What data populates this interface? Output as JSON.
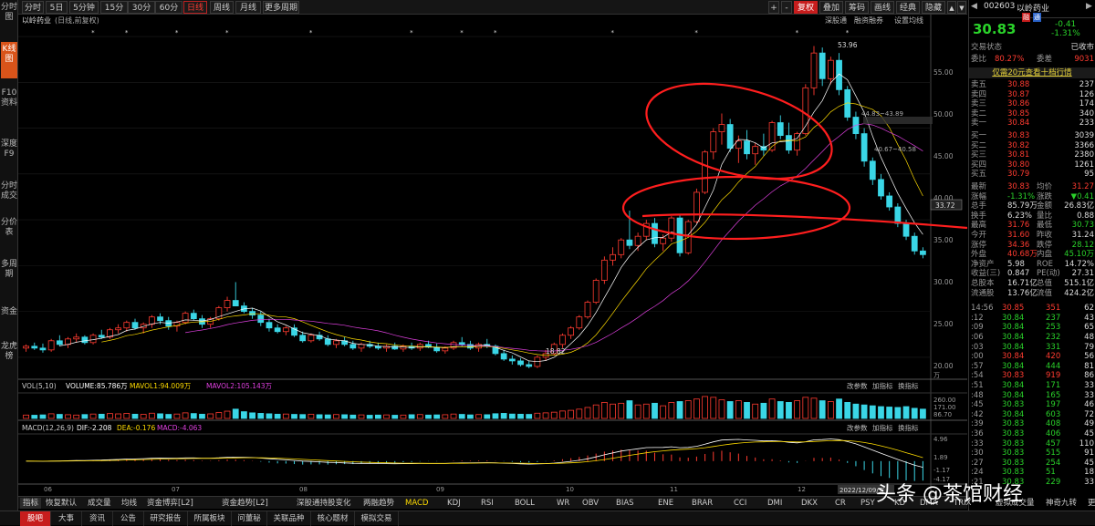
{
  "sidebar": {
    "items": [
      "分时图",
      "K线图",
      "F10资料",
      "深度F9",
      "分时成交",
      "分价表",
      "多周期",
      "资金",
      "龙虎榜"
    ],
    "active": 1
  },
  "toolbar": {
    "periods": [
      "分时",
      "5日",
      "5分钟",
      "15分钟",
      "30分钟",
      "60分钟",
      "日线",
      "周线",
      "月线",
      "更多周期"
    ],
    "selected_period": "日线",
    "right_buttons": [
      "+",
      "-",
      "复权",
      "叠加",
      "筹码",
      "画线",
      "经典",
      "隐藏"
    ],
    "right_icons": [
      "▲",
      "▼",
      "◀",
      "▶"
    ]
  },
  "chart": {
    "stock_label": "以岭药业",
    "stock_label_sub": "(日线,前复权)",
    "subtoolbar": [
      "深股通",
      "融资融券",
      "设置均线"
    ],
    "price_axis": [
      "55.00",
      "50.00",
      "45.00",
      "40.00",
      "35.00",
      "30.00",
      "25.00",
      "20.00"
    ],
    "current_price_tag": "33.72",
    "high_label": "53.96",
    "low_label": "18.82",
    "range_label_1": "44.83~43.89",
    "range_label_2": "40.67~40.58",
    "month_labels": [
      "06",
      "07",
      "08",
      "09",
      "10",
      "11",
      "12"
    ],
    "date_tag": "2022/12/09/五",
    "vol_header": "VOL(5,10)",
    "vol_values": [
      "VOLUME:85.786万",
      "MAVOL1:94.009万",
      "MAVOL2:105.143万"
    ],
    "vol_right": [
      "改参数",
      "加指标",
      "换指标"
    ],
    "vol_axis": [
      "260.00",
      "171.00",
      "86.70",
      "万"
    ],
    "macd_header": "MACD(12,26,9)",
    "macd_values": [
      "DIF:-2.208",
      "DEA:-0.176",
      "MACD:-4.063"
    ],
    "macd_right": [
      "改参数",
      "加指标",
      "换指标"
    ],
    "macd_axis": [
      "4.96",
      "1.89",
      "-1.17",
      "-4.17"
    ]
  },
  "chart_data": {
    "type": "candlestick",
    "title": "以岭药业 (日线,前复权)",
    "ylim": [
      18,
      56
    ],
    "candles": [
      [
        21.0,
        21.4,
        20.6,
        21.2
      ],
      [
        21.2,
        21.6,
        20.8,
        21.0
      ],
      [
        21.0,
        21.5,
        20.5,
        20.8
      ],
      [
        20.8,
        22.0,
        20.6,
        21.8
      ],
      [
        21.8,
        22.4,
        21.2,
        21.4
      ],
      [
        21.4,
        22.2,
        21.0,
        22.0
      ],
      [
        22.0,
        22.6,
        21.6,
        22.2
      ],
      [
        22.2,
        22.4,
        21.4,
        21.6
      ],
      [
        21.6,
        22.6,
        21.4,
        22.4
      ],
      [
        22.4,
        23.0,
        22.0,
        22.2
      ],
      [
        22.2,
        23.2,
        22.0,
        23.0
      ],
      [
        23.0,
        23.6,
        22.6,
        23.2
      ],
      [
        23.2,
        24.0,
        22.8,
        23.8
      ],
      [
        23.8,
        24.2,
        23.0,
        23.2
      ],
      [
        23.2,
        23.8,
        22.6,
        23.6
      ],
      [
        23.6,
        24.6,
        23.2,
        24.4
      ],
      [
        24.4,
        24.8,
        23.6,
        24.0
      ],
      [
        24.0,
        24.4,
        23.0,
        23.4
      ],
      [
        23.4,
        24.0,
        22.8,
        23.8
      ],
      [
        23.8,
        25.0,
        23.6,
        24.8
      ],
      [
        24.8,
        25.2,
        24.0,
        24.2
      ],
      [
        24.2,
        24.6,
        23.2,
        23.6
      ],
      [
        23.6,
        24.4,
        23.2,
        24.2
      ],
      [
        24.2,
        25.6,
        24.0,
        25.4
      ],
      [
        25.4,
        26.6,
        25.0,
        26.2
      ],
      [
        26.2,
        28.2,
        25.8,
        25.6
      ],
      [
        25.6,
        26.0,
        24.8,
        25.0
      ],
      [
        25.0,
        25.4,
        24.2,
        24.6
      ],
      [
        24.6,
        25.0,
        23.4,
        23.8
      ],
      [
        23.8,
        24.2,
        22.8,
        23.2
      ],
      [
        23.2,
        23.6,
        22.6,
        22.8
      ],
      [
        22.8,
        23.4,
        22.4,
        23.2
      ],
      [
        23.2,
        23.6,
        22.2,
        22.4
      ],
      [
        22.4,
        22.8,
        21.6,
        21.8
      ],
      [
        21.8,
        22.6,
        21.6,
        22.4
      ],
      [
        22.4,
        22.8,
        21.8,
        22.0
      ],
      [
        22.0,
        22.4,
        21.2,
        21.4
      ],
      [
        21.4,
        22.0,
        21.0,
        21.8
      ],
      [
        21.8,
        22.2,
        21.2,
        21.4
      ],
      [
        21.4,
        21.8,
        20.8,
        21.0
      ],
      [
        21.0,
        21.6,
        20.6,
        21.4
      ],
      [
        21.4,
        21.8,
        21.0,
        21.2
      ],
      [
        21.2,
        21.6,
        20.8,
        21.0
      ],
      [
        21.0,
        21.4,
        20.6,
        21.2
      ],
      [
        21.2,
        21.6,
        20.8,
        20.9
      ],
      [
        20.9,
        21.4,
        20.6,
        21.2
      ],
      [
        21.2,
        21.6,
        20.8,
        21.0
      ],
      [
        21.0,
        21.6,
        20.7,
        21.4
      ],
      [
        21.4,
        21.8,
        21.0,
        21.1
      ],
      [
        21.1,
        21.5,
        20.5,
        20.7
      ],
      [
        20.7,
        21.2,
        20.4,
        21.0
      ],
      [
        21.0,
        21.8,
        20.8,
        21.6
      ],
      [
        21.6,
        22.2,
        21.2,
        21.4
      ],
      [
        21.4,
        21.8,
        20.8,
        21.0
      ],
      [
        21.0,
        21.6,
        20.6,
        21.4
      ],
      [
        21.4,
        22.0,
        21.0,
        21.2
      ],
      [
        21.2,
        21.4,
        20.2,
        20.4
      ],
      [
        20.4,
        20.8,
        19.6,
        19.8
      ],
      [
        19.8,
        20.2,
        19.2,
        19.6
      ],
      [
        19.6,
        19.9,
        19.0,
        19.2
      ],
      [
        19.2,
        19.6,
        18.8,
        19.0
      ],
      [
        19.0,
        20.2,
        18.82,
        20.0
      ],
      [
        20.0,
        20.8,
        19.6,
        20.4
      ],
      [
        20.4,
        21.6,
        20.2,
        21.4
      ],
      [
        21.4,
        22.6,
        21.0,
        22.4
      ],
      [
        22.4,
        23.4,
        22.0,
        23.2
      ],
      [
        23.2,
        24.6,
        23.0,
        24.4
      ],
      [
        24.4,
        26.2,
        24.2,
        26.0
      ],
      [
        26.0,
        28.6,
        25.8,
        28.4
      ],
      [
        28.4,
        31.0,
        28.0,
        30.6
      ],
      [
        30.6,
        32.0,
        30.0,
        31.2
      ],
      [
        31.2,
        33.0,
        30.8,
        32.8
      ],
      [
        32.8,
        36.0,
        31.8,
        32.2
      ],
      [
        32.2,
        33.6,
        31.6,
        33.2
      ],
      [
        33.2,
        35.0,
        32.8,
        34.6
      ],
      [
        34.6,
        35.2,
        32.0,
        32.4
      ],
      [
        32.4,
        33.4,
        31.6,
        33.0
      ],
      [
        33.0,
        35.4,
        32.6,
        35.2
      ],
      [
        35.2,
        35.6,
        31.0,
        31.4
      ],
      [
        31.4,
        35.0,
        31.2,
        34.8
      ],
      [
        34.8,
        38.4,
        34.6,
        38.0
      ],
      [
        38.0,
        42.6,
        37.8,
        42.4
      ],
      [
        42.4,
        45.0,
        41.6,
        44.6
      ],
      [
        44.6,
        46.6,
        43.2,
        45.4
      ],
      [
        45.4,
        46.0,
        42.4,
        42.8
      ],
      [
        42.8,
        44.2,
        41.2,
        43.6
      ],
      [
        43.6,
        44.8,
        41.6,
        42.2
      ],
      [
        42.2,
        43.4,
        41.0,
        43.0
      ],
      [
        43.0,
        44.4,
        42.0,
        42.6
      ],
      [
        42.6,
        45.8,
        42.4,
        45.6
      ],
      [
        45.6,
        46.4,
        43.8,
        44.2
      ],
      [
        44.2,
        45.6,
        42.2,
        42.6
      ],
      [
        42.6,
        44.6,
        42.0,
        44.4
      ],
      [
        44.4,
        49.8,
        44.2,
        49.4
      ],
      [
        49.4,
        53.96,
        48.6,
        53.2
      ],
      [
        53.2,
        53.8,
        49.6,
        50.4
      ],
      [
        50.4,
        52.8,
        49.8,
        52.4
      ],
      [
        52.4,
        53.2,
        48.6,
        49.2
      ],
      [
        49.2,
        49.6,
        45.8,
        46.2
      ],
      [
        46.2,
        46.8,
        43.8,
        44.4
      ],
      [
        44.4,
        45.0,
        40.8,
        41.4
      ],
      [
        41.4,
        41.8,
        38.8,
        39.4
      ],
      [
        39.4,
        40.0,
        37.2,
        37.6
      ],
      [
        37.6,
        38.0,
        36.0,
        36.4
      ],
      [
        36.4,
        36.8,
        34.2,
        34.6
      ],
      [
        34.6,
        35.0,
        32.8,
        33.2
      ],
      [
        33.2,
        33.6,
        31.2,
        31.6
      ],
      [
        31.6,
        32.0,
        30.8,
        31.2
      ]
    ],
    "volume": [
      40,
      38,
      42,
      55,
      48,
      44,
      40,
      46,
      52,
      50,
      58,
      54,
      60,
      50,
      48,
      62,
      55,
      48,
      52,
      66,
      58,
      50,
      54,
      70,
      86,
      110,
      80,
      66,
      60,
      55,
      50,
      52,
      48,
      46,
      50,
      44,
      42,
      46,
      44,
      40,
      42,
      38,
      40,
      42,
      38,
      40,
      44,
      46,
      40,
      42,
      44,
      52,
      48,
      42,
      46,
      44,
      56,
      60,
      52,
      50,
      48,
      62,
      66,
      74,
      88,
      96,
      110,
      130,
      160,
      190,
      170,
      180,
      210,
      160,
      170,
      180,
      150,
      190,
      200,
      210,
      230,
      260,
      250,
      220,
      200,
      210,
      190,
      170,
      180,
      230,
      200,
      190,
      210,
      250,
      240,
      210,
      200,
      230,
      190,
      170,
      160,
      150,
      140,
      135,
      130,
      140,
      120,
      110
    ],
    "vol_ylim": [
      0,
      270
    ],
    "macd_ylim": [
      -5,
      6
    ]
  },
  "rpanel": {
    "code": "002603",
    "name": "以岭药业",
    "badges": [
      "融",
      "通"
    ],
    "price": "30.83",
    "change": "-0.41",
    "pct": "-1.31%",
    "status_label": "交易状态",
    "status_value": "已收市",
    "weibi_label": "委比",
    "weibi_value": "80.27%",
    "weicha_label": "委差",
    "weicha_value": "9031",
    "promo": "仅需20元查看十档行情",
    "sells": [
      [
        "卖五",
        "30.88",
        "237"
      ],
      [
        "卖四",
        "30.87",
        "126"
      ],
      [
        "卖三",
        "30.86",
        "174"
      ],
      [
        "卖二",
        "30.85",
        "340"
      ],
      [
        "卖一",
        "30.84",
        "233"
      ]
    ],
    "buys": [
      [
        "买一",
        "30.83",
        "3039"
      ],
      [
        "买二",
        "30.82",
        "3366"
      ],
      [
        "买三",
        "30.81",
        "2380"
      ],
      [
        "买四",
        "30.80",
        "1261"
      ],
      [
        "买五",
        "30.79",
        "95"
      ]
    ],
    "stats": [
      [
        "最新",
        "30.83",
        "均价",
        "31.27"
      ],
      [
        "涨幅",
        "-1.31%",
        "涨跌",
        "▼0.41"
      ],
      [
        "总手",
        "85.79万",
        "金额",
        "26.83亿"
      ],
      [
        "换手",
        "6.23%",
        "量比",
        "0.88"
      ],
      [
        "最高",
        "31.76",
        "最低",
        "30.73"
      ],
      [
        "今开",
        "31.60",
        "昨收",
        "31.24"
      ],
      [
        "涨停",
        "34.36",
        "跌停",
        "28.12"
      ],
      [
        "外盘",
        "40.68万",
        "内盘",
        "45.10万"
      ],
      [
        "净资产",
        "5.98",
        "ROE",
        "14.72%"
      ],
      [
        "收益(三)",
        "0.847",
        "PE(动)",
        "27.31"
      ],
      [
        "总股本",
        "16.71亿",
        "总值",
        "515.1亿"
      ],
      [
        "流通股",
        "13.76亿",
        "流值",
        "424.2亿"
      ]
    ],
    "ticks": [
      [
        "14:56",
        "30.85",
        "351",
        "62"
      ],
      [
        ":12",
        "30.84",
        "237",
        "43"
      ],
      [
        ":09",
        "30.84",
        "253",
        "65"
      ],
      [
        ":06",
        "30.84",
        "232",
        "48"
      ],
      [
        ":03",
        "30.84",
        "331",
        "79"
      ],
      [
        ":00",
        "30.84",
        "420",
        "56"
      ],
      [
        ":57",
        "30.84",
        "444",
        "81"
      ],
      [
        ":54",
        "30.83",
        "919",
        "86"
      ],
      [
        ":51",
        "30.84",
        "171",
        "33"
      ],
      [
        ":48",
        "30.84",
        "165",
        "33"
      ],
      [
        ":45",
        "30.83",
        "197",
        "46"
      ],
      [
        ":42",
        "30.84",
        "603",
        "72"
      ],
      [
        ":39",
        "30.83",
        "408",
        "49"
      ],
      [
        ":36",
        "30.83",
        "406",
        "45"
      ],
      [
        ":33",
        "30.83",
        "457",
        "110"
      ],
      [
        ":30",
        "30.83",
        "515",
        "91"
      ],
      [
        ":27",
        "30.83",
        "254",
        "45"
      ],
      [
        ":24",
        "30.83",
        "51",
        "18"
      ],
      [
        ":21",
        "30.83",
        "229",
        "33"
      ]
    ]
  },
  "indicator_tabs": [
    "指标",
    "恢复默认",
    "成交量",
    "均线",
    "资金博弈[L2]",
    "资金趋势[L2]",
    "深股通持股变化",
    "两融趋势",
    "MACD",
    "KDJ",
    "RSI",
    "BOLL",
    "WR",
    "OBV",
    "BIAS",
    "ENE",
    "BRAR",
    "CCI",
    "DMI",
    "DKX",
    "CR",
    "PSY",
    "KD",
    "DMA",
    "TRIX",
    "虚拟成交量",
    "神奇九转",
    "更多指标"
  ],
  "status_tabs": [
    "股吧",
    "大事",
    "资讯",
    "公告",
    "研究报告",
    "所属板块",
    "问董秘",
    "关联品种",
    "核心题材",
    "模拟交易"
  ],
  "watermark": "头条 @茶馆财经"
}
